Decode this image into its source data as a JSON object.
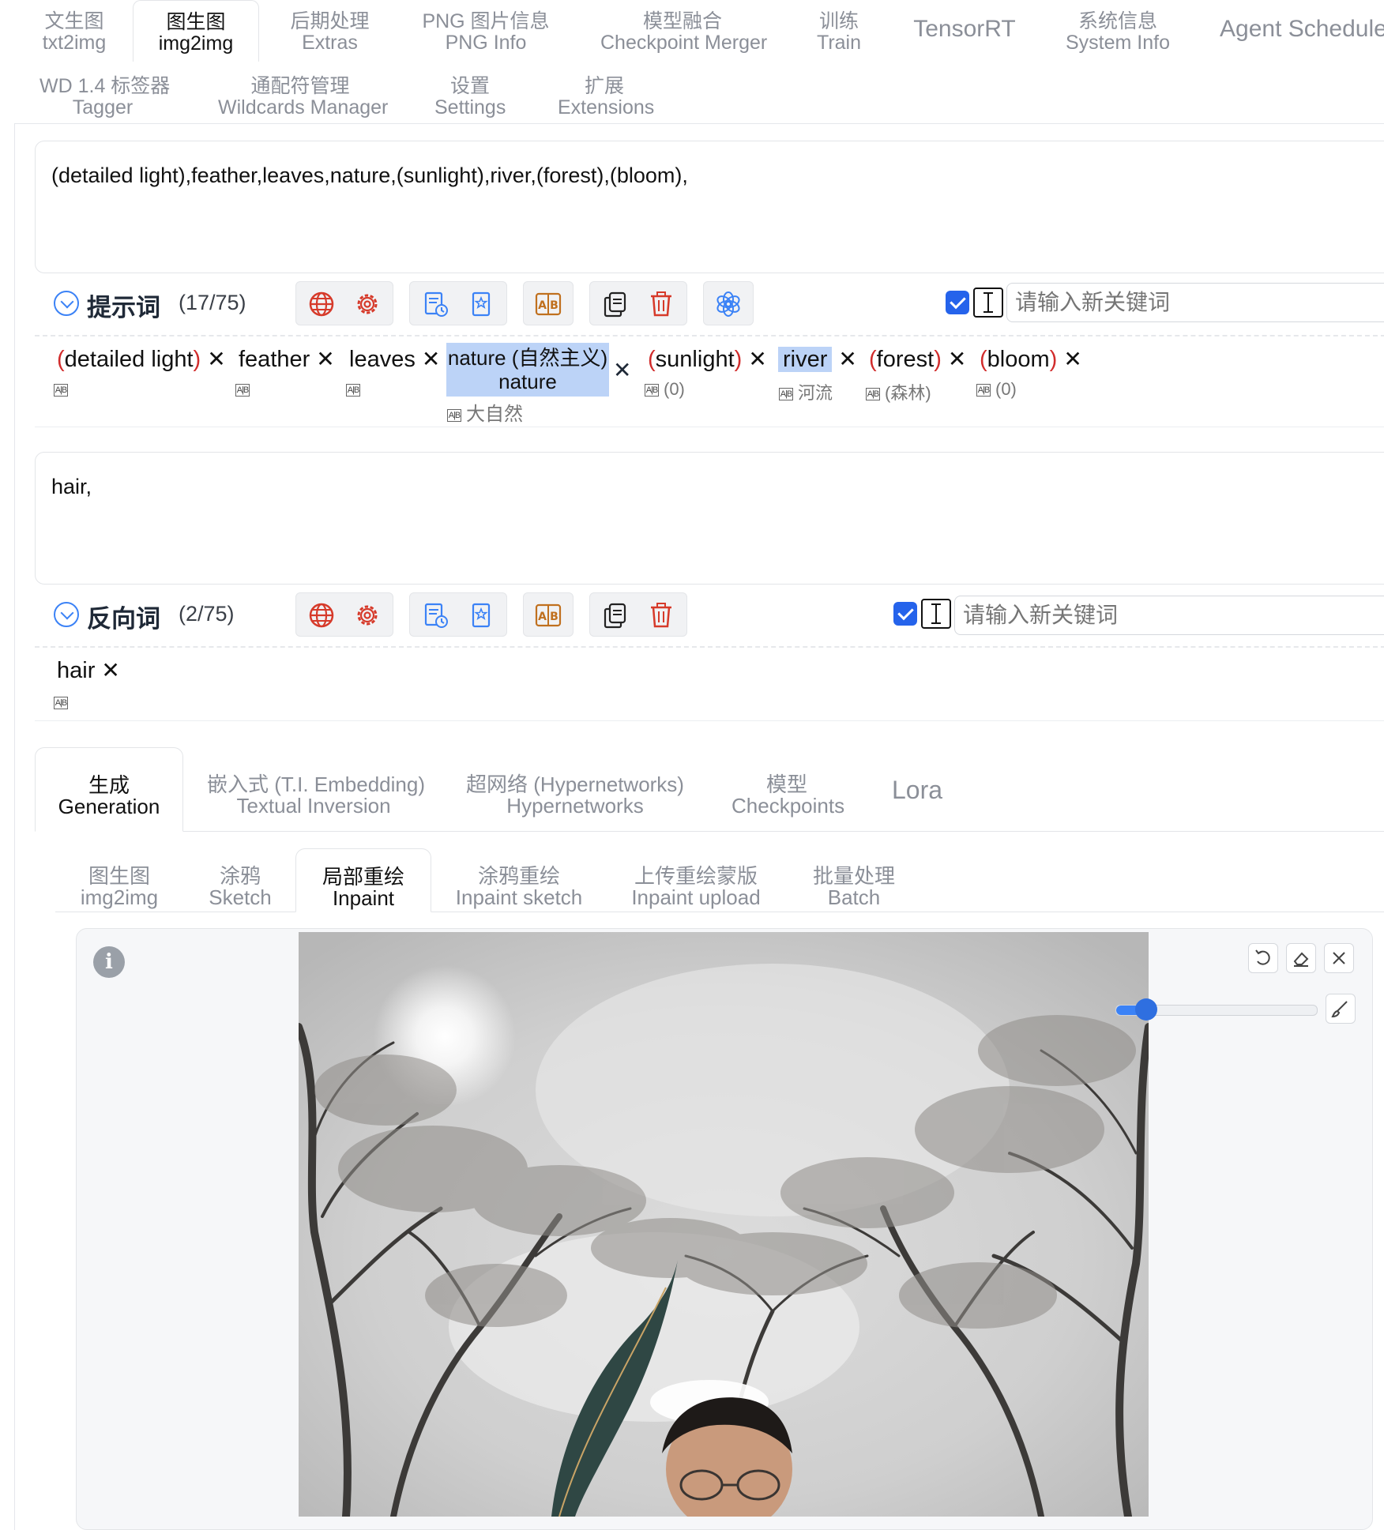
{
  "nav": {
    "row1": [
      {
        "zh": "文生图",
        "en": "txt2img"
      },
      {
        "zh": "图生图",
        "en": "img2img",
        "active": true
      },
      {
        "zh": "后期处理",
        "en": "Extras"
      },
      {
        "zh": "PNG 图片信息",
        "en": "PNG Info"
      },
      {
        "zh": "模型融合",
        "en": "Checkpoint Merger"
      },
      {
        "zh": "训练",
        "en": "Train"
      },
      {
        "label": "TensorRT"
      },
      {
        "zh": "系统信息",
        "en": "System Info"
      },
      {
        "label": "Agent Schedule"
      }
    ],
    "row2": [
      {
        "zh": "WD 1.4 标签器",
        "en": "Tagger"
      },
      {
        "zh": "通配符管理",
        "en": "Wildcards Manager"
      },
      {
        "zh": "设置",
        "en": "Settings"
      },
      {
        "zh": "扩展",
        "en": "Extensions"
      }
    ]
  },
  "prompt": {
    "text": "(detailed light),feather,leaves,nature,(sunlight),river,(forest),(bloom),",
    "label": "提示词",
    "count": "(17/75)",
    "keyword_placeholder": "请输入新关键词",
    "use_checkbox_checked": true,
    "tags": [
      {
        "text": "detailed light",
        "parens": true,
        "sub": ""
      },
      {
        "text": "feather",
        "parens": false,
        "sub": ""
      },
      {
        "text": "leaves",
        "parens": false,
        "sub": ""
      },
      {
        "text": "nature (自然主义)",
        "line2": "nature",
        "parens": false,
        "highlight": true,
        "sub": "大自然"
      },
      {
        "text": "sunlight",
        "parens": true,
        "sub": "(0)"
      },
      {
        "text": "river",
        "parens": false,
        "highlight": true,
        "sub": "河流"
      },
      {
        "text": "forest",
        "parens": true,
        "sub": "(森林)"
      },
      {
        "text": "bloom",
        "parens": true,
        "sub": "(0)"
      }
    ]
  },
  "negative": {
    "text": "hair,",
    "label": "反向词",
    "count": "(2/75)",
    "keyword_placeholder": "请输入新关键词",
    "use_checkbox_checked": true,
    "tags": [
      {
        "text": "hair",
        "parens": false,
        "sub": ""
      }
    ]
  },
  "translate_icon_text": "A|B",
  "close_glyph": "✕",
  "extra_tabs": [
    {
      "zh": "生成",
      "en": "Generation",
      "active": true
    },
    {
      "zh": "嵌入式 (T.I. Embedding)",
      "en": "Textual Inversion"
    },
    {
      "zh": "超网络 (Hypernetworks)",
      "en": "Hypernetworks"
    },
    {
      "zh": "模型",
      "en": "Checkpoints"
    },
    {
      "label": "Lora"
    }
  ],
  "mode_tabs": [
    {
      "zh": "图生图",
      "en": "img2img"
    },
    {
      "zh": "涂鸦",
      "en": "Sketch"
    },
    {
      "zh": "局部重绘",
      "en": "Inpaint",
      "active": true
    },
    {
      "zh": "涂鸦重绘",
      "en": "Inpaint sketch"
    },
    {
      "zh": "上传重绘蒙版",
      "en": "Inpaint upload"
    },
    {
      "zh": "批量处理",
      "en": "Batch"
    }
  ],
  "canvas": {
    "info_glyph": "i",
    "brush_size": 0.15,
    "image_description": "inpaint-source-image"
  },
  "colors": {
    "accent": "#3b82f6",
    "paren_red": "#d12c2c",
    "tag_highlight": "#bcd3f7",
    "icon_red": "#d63a2a",
    "icon_blue": "#3b82f6",
    "icon_orange": "#c0701e"
  }
}
